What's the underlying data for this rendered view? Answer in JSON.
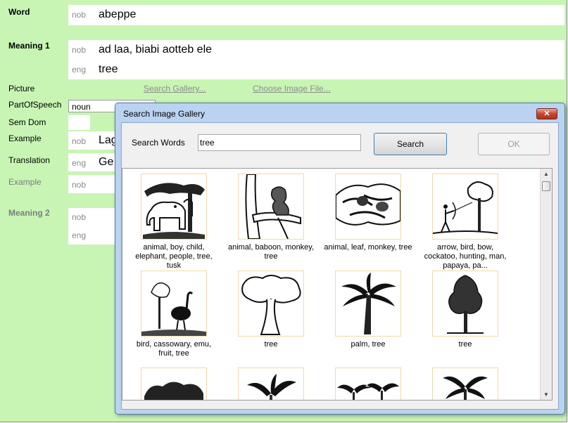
{
  "editor": {
    "word_label": "Word",
    "word_ws": "nob",
    "word_value": "abeppe",
    "meaning1_label": "Meaning 1",
    "meaning1_nob_ws": "nob",
    "meaning1_nob_value": "ad laa, biabi aotteb ele",
    "meaning1_eng_ws": "eng",
    "meaning1_eng_value": "tree",
    "picture_label": "Picture",
    "search_gallery_link": "Search Gallery...",
    "choose_image_link": "Choose Image File...",
    "pos_label": "PartOfSpeech",
    "pos_value": "noun",
    "semdom_label": "Sem Dom",
    "example_label": "Example",
    "example_ws": "nob",
    "example_value_partial": "Lag",
    "translation_label": "Translation",
    "translation_ws": "eng",
    "translation_value_partial": "Ge",
    "example2_label": "Example",
    "example2_ws": "nob",
    "meaning2_label": "Meaning 2",
    "meaning2_nob_ws": "nob",
    "meaning2_eng_ws": "eng"
  },
  "dialog": {
    "title": "Search Image Gallery",
    "close_glyph": "✕",
    "search_words_label": "Search Words",
    "search_value": "tree",
    "search_button": "Search",
    "ok_button": "OK",
    "items": [
      {
        "caption": "animal, boy, child, elephant, people, tree, tusk",
        "icon": "elephant-boy-picture"
      },
      {
        "caption": "animal, baboon, monkey, tree",
        "icon": "baboon-picture"
      },
      {
        "caption": "animal, leaf, monkey, tree",
        "icon": "monkey-leaf-picture"
      },
      {
        "caption": "arrow, bird, bow, cockatoo, hunting, man, papaya, pa...",
        "icon": "hunter-picture"
      },
      {
        "caption": "bird, cassowary, emu, fruit, tree",
        "icon": "cassowary-picture"
      },
      {
        "caption": "tree",
        "icon": "tree-picture"
      },
      {
        "caption": "palm, tree",
        "icon": "palm-picture"
      },
      {
        "caption": "tree",
        "icon": "tree-picture-2"
      },
      {
        "caption": "",
        "icon": "bush-picture"
      },
      {
        "caption": "",
        "icon": "banana-picture"
      },
      {
        "caption": "",
        "icon": "palms-picture"
      },
      {
        "caption": "",
        "icon": "palm-picture-2"
      }
    ]
  }
}
